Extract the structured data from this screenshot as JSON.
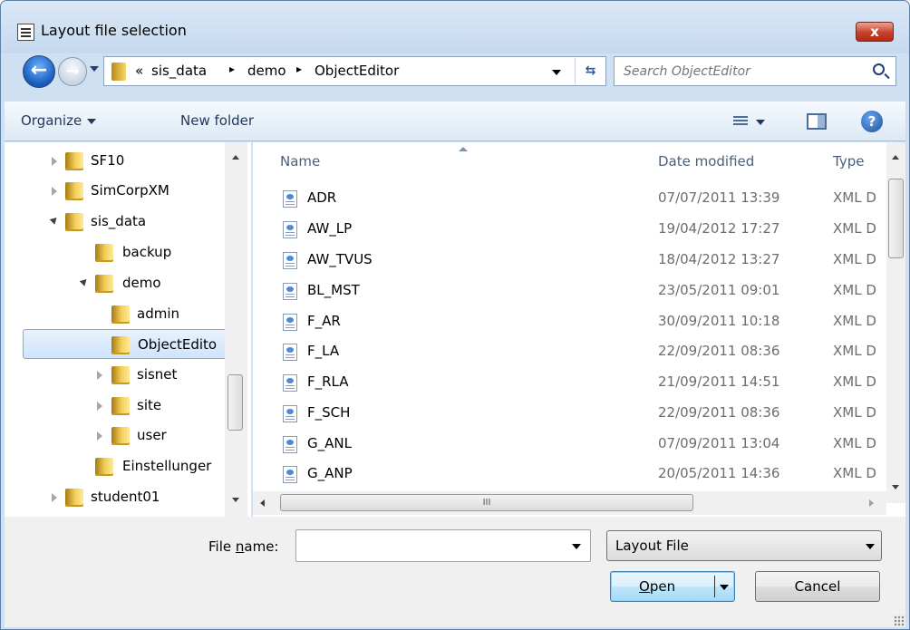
{
  "window": {
    "title": "Layout file selection",
    "close_glyph": "x"
  },
  "address": {
    "overflow": "«",
    "segments": [
      "sis_data",
      "demo",
      "ObjectEditor"
    ],
    "separator": "▸"
  },
  "search": {
    "placeholder": "Search ObjectEditor"
  },
  "toolbar": {
    "organize_label": "Organize",
    "new_folder_label": "New folder"
  },
  "nav_tree": [
    {
      "label": "SF10",
      "expander": "collapsed",
      "indent": 1
    },
    {
      "label": "SimCorpXM",
      "expander": "collapsed",
      "indent": 1
    },
    {
      "label": "sis_data",
      "expander": "expanded",
      "indent": 1
    },
    {
      "label": "backup",
      "expander": "none",
      "indent": 2
    },
    {
      "label": "demo",
      "expander": "expanded",
      "indent": 2
    },
    {
      "label": "admin",
      "expander": "none",
      "indent": 3
    },
    {
      "label": "ObjectEdito",
      "expander": "none",
      "indent": 3,
      "selected": true
    },
    {
      "label": "sisnet",
      "expander": "collapsed",
      "indent": 3
    },
    {
      "label": "site",
      "expander": "collapsed",
      "indent": 3
    },
    {
      "label": "user",
      "expander": "collapsed",
      "indent": 3
    },
    {
      "label": "Einstellunger",
      "expander": "none",
      "indent": 2
    },
    {
      "label": "student01",
      "expander": "collapsed",
      "indent": 1
    }
  ],
  "file_list": {
    "columns": {
      "name": "Name",
      "date": "Date modified",
      "type": "Type"
    },
    "rows": [
      {
        "name": "ADR",
        "date": "07/07/2011 13:39",
        "type": "XML D"
      },
      {
        "name": "AW_LP",
        "date": "19/04/2012 17:27",
        "type": "XML D"
      },
      {
        "name": "AW_TVUS",
        "date": "18/04/2012 13:27",
        "type": "XML D"
      },
      {
        "name": "BL_MST",
        "date": "23/05/2011 09:01",
        "type": "XML D"
      },
      {
        "name": "F_AR",
        "date": "30/09/2011 10:18",
        "type": "XML D"
      },
      {
        "name": "F_LA",
        "date": "22/09/2011 08:36",
        "type": "XML D"
      },
      {
        "name": "F_RLA",
        "date": "21/09/2011 14:51",
        "type": "XML D"
      },
      {
        "name": "F_SCH",
        "date": "22/09/2011 08:36",
        "type": "XML D"
      },
      {
        "name": "G_ANL",
        "date": "07/09/2011 13:04",
        "type": "XML D"
      },
      {
        "name": "G_ANP",
        "date": "20/05/2011 14:36",
        "type": "XML D"
      }
    ],
    "hscroll_grip": "III"
  },
  "footer": {
    "filename_label_pre": "File ",
    "filename_label_mnemonic": "n",
    "filename_label_post": "ame:",
    "filename_value": "",
    "filetype_value": "Layout File",
    "open_mnemonic": "O",
    "open_rest": "pen",
    "cancel_label": "Cancel"
  }
}
